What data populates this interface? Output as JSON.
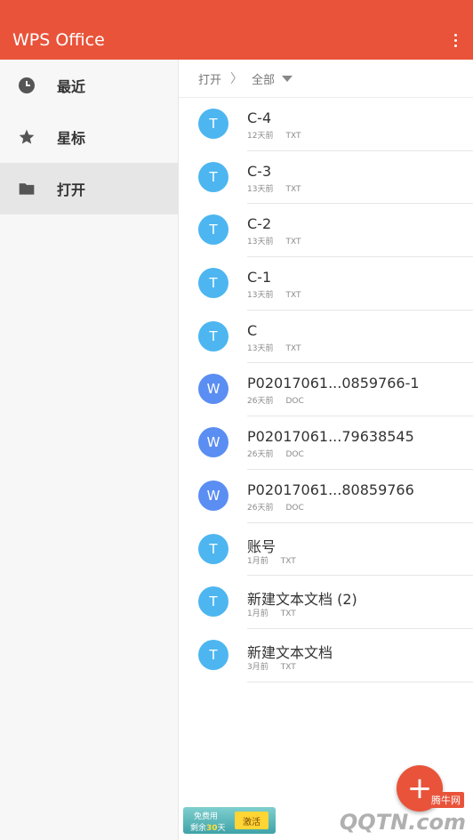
{
  "app": {
    "title": "WPS Office"
  },
  "sidebar": {
    "items": [
      {
        "label": "最近",
        "icon": "clock-icon",
        "active": false
      },
      {
        "label": "星标",
        "icon": "star-icon",
        "active": false
      },
      {
        "label": "打开",
        "icon": "folder-icon",
        "active": true
      }
    ]
  },
  "breadcrumb": {
    "root": "打开",
    "current": "全部"
  },
  "files": [
    {
      "name": "C-4",
      "time": "12天前",
      "type": "TXT",
      "badge": "T",
      "color": "#4db6f0"
    },
    {
      "name": "C-3",
      "time": "13天前",
      "type": "TXT",
      "badge": "T",
      "color": "#4db6f0"
    },
    {
      "name": "C-2",
      "time": "13天前",
      "type": "TXT",
      "badge": "T",
      "color": "#4db6f0"
    },
    {
      "name": "C-1",
      "time": "13天前",
      "type": "TXT",
      "badge": "T",
      "color": "#4db6f0"
    },
    {
      "name": "C",
      "time": "13天前",
      "type": "TXT",
      "badge": "T",
      "color": "#4db6f0"
    },
    {
      "name": "P02017061...0859766-1",
      "time": "26天前",
      "type": "DOC",
      "badge": "W",
      "color": "#5b8ef2"
    },
    {
      "name": "P02017061...79638545",
      "time": "26天前",
      "type": "DOC",
      "badge": "W",
      "color": "#5b8ef2"
    },
    {
      "name": "P02017061...80859766",
      "time": "26天前",
      "type": "DOC",
      "badge": "W",
      "color": "#5b8ef2"
    },
    {
      "name": "账号",
      "time": "1月前",
      "type": "TXT",
      "badge": "T",
      "color": "#4db6f0"
    },
    {
      "name": "新建文本文档 (2)",
      "time": "1月前",
      "type": "TXT",
      "badge": "T",
      "color": "#4db6f0"
    },
    {
      "name": "新建文本文档",
      "time": "3月前",
      "type": "TXT",
      "badge": "T",
      "color": "#4db6f0"
    }
  ],
  "fab": {
    "label": "+"
  },
  "promo": {
    "line1": "免费用",
    "line2_prefix": "剩余",
    "days": "30",
    "line2_suffix": "天",
    "button": "激活"
  },
  "watermark": {
    "text": "QQTN.com",
    "badge": "腾牛网"
  },
  "colors": {
    "accent": "#e8533a",
    "txt_badge": "#4db6f0",
    "doc_badge": "#5b8ef2"
  }
}
